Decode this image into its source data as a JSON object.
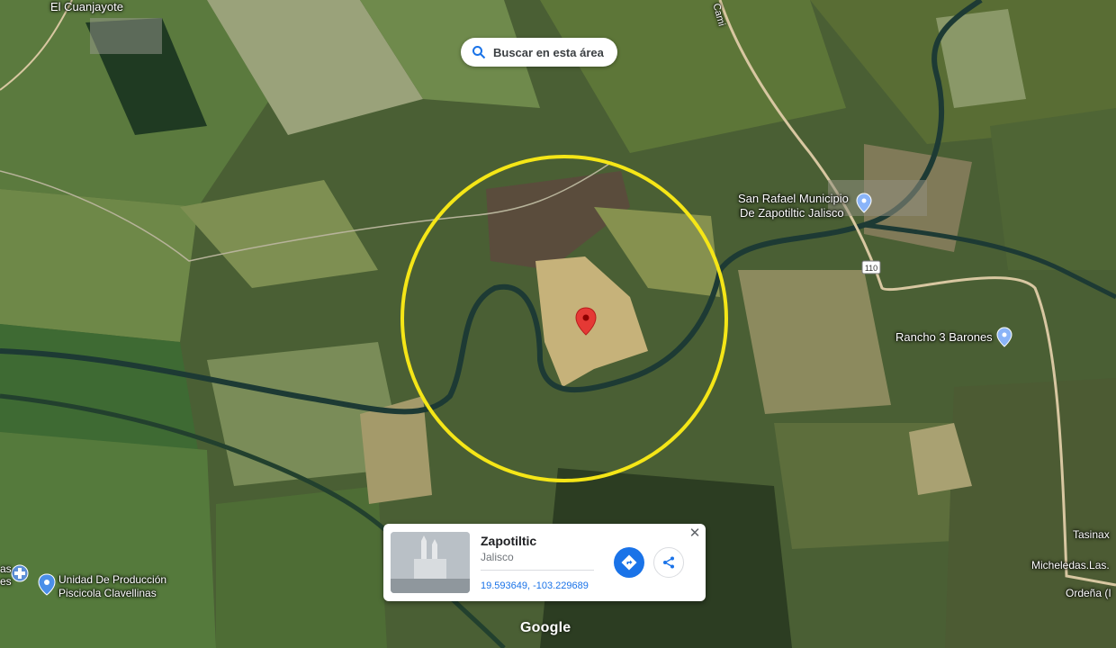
{
  "search_button": {
    "label": "Buscar en esta área",
    "icon": "search-icon"
  },
  "places": {
    "el_cuanjayote": "El Cuanjayote",
    "san_rafael_line1": "San Rafael Municipio",
    "san_rafael_line2": "De Zapotiltic Jalisco",
    "rancho": "Rancho 3 Barones",
    "unidad_line1": "Unidad De Producción",
    "unidad_line2": "Piscicola Clavellinas",
    "tasinax": "Tasinax",
    "micheledas": "Micheledas.Las.",
    "ordena": "Ordeña (I",
    "left_partial_1": "as",
    "left_partial_2": "es",
    "road_top": "Cami"
  },
  "highway_shield": "110",
  "place_card": {
    "title": "Zapotiltic",
    "subtitle": "Jalisco",
    "coordinates": "19.593649, -103.229689",
    "directions_icon": "directions-icon",
    "share_icon": "share-icon",
    "close_label": "✕"
  },
  "logo": "Google",
  "colors": {
    "highlight_circle": "#f5e617",
    "pin": "#e53935",
    "accent": "#1a73e8"
  }
}
